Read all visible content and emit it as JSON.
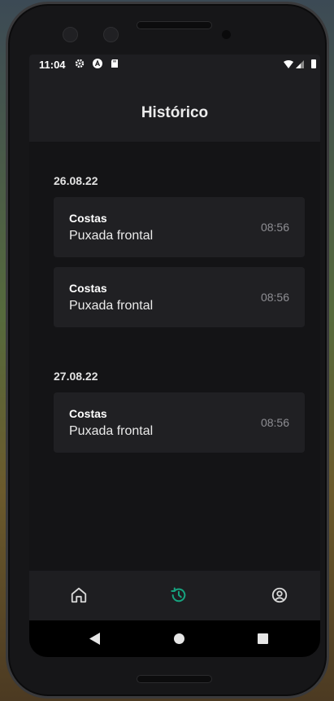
{
  "status_bar": {
    "time": "11:04",
    "icons": [
      "settings-icon",
      "a-icon",
      "sd-card-icon",
      "wifi-icon",
      "signal-icon",
      "battery-icon"
    ]
  },
  "header": {
    "title": "Histórico"
  },
  "history": [
    {
      "date": "26.08.22",
      "entries": [
        {
          "title": "Costas",
          "exercise": "Puxada frontal",
          "time": "08:56"
        },
        {
          "title": "Costas",
          "exercise": "Puxada frontal",
          "time": "08:56"
        }
      ]
    },
    {
      "date": "27.08.22",
      "entries": [
        {
          "title": "Costas",
          "exercise": "Puxada frontal",
          "time": "08:56"
        }
      ]
    }
  ],
  "bottom_nav": {
    "items": [
      {
        "icon": "home-icon",
        "active": false
      },
      {
        "icon": "history-icon",
        "active": true
      },
      {
        "icon": "profile-icon",
        "active": false
      }
    ],
    "active_color": "#16a37f",
    "inactive_color": "#d8d8d8"
  },
  "system_nav": {
    "icons": [
      "back-icon",
      "home-circle-icon",
      "recents-icon"
    ]
  }
}
